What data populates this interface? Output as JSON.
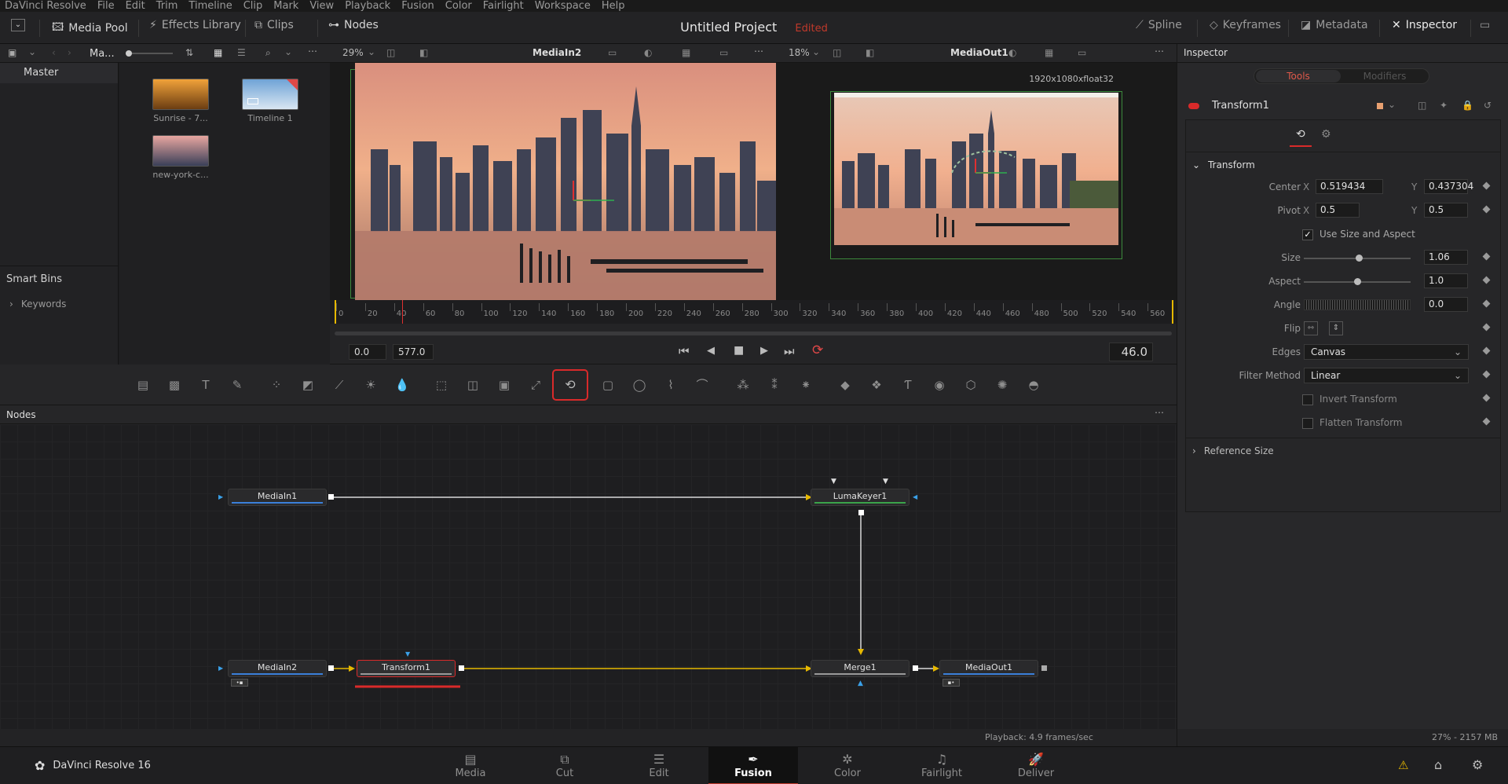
{
  "menu": [
    "DaVinci Resolve",
    "File",
    "Edit",
    "Trim",
    "Timeline",
    "Clip",
    "Mark",
    "View",
    "Playback",
    "Fusion",
    "Color",
    "Fairlight",
    "Workspace",
    "Help"
  ],
  "toolbar": {
    "media_pool": "Media Pool",
    "effects_library": "Effects Library",
    "clips": "Clips",
    "nodes": "Nodes",
    "project_title": "Untitled Project",
    "project_status": "Edited",
    "spline": "Spline",
    "keyframes": "Keyframes",
    "metadata": "Metadata",
    "inspector": "Inspector"
  },
  "media_pool": {
    "breadcrumb": "Ma...",
    "bins": {
      "master": "Master",
      "smart_bins": "Smart Bins",
      "keywords": "Keywords"
    },
    "clips": [
      {
        "name": "Sunrise - 7...",
        "colors": [
          "#f1a23a",
          "#6b3d12"
        ]
      },
      {
        "name": "Timeline 1",
        "colors": [
          "#6fa3d6",
          "#d9e6f2"
        ]
      },
      {
        "name": "new-york-c...",
        "colors": [
          "#e8a6a0",
          "#3a3f58"
        ]
      }
    ]
  },
  "viewer_left": {
    "zoom": "29%",
    "name": "MediaIn2"
  },
  "viewer_right": {
    "zoom": "18%",
    "name": "MediaOut1",
    "resolution": "1920x1080xfloat32"
  },
  "timeline": {
    "ticks": [
      "0",
      "20",
      "40",
      "60",
      "80",
      "100",
      "120",
      "140",
      "160",
      "180",
      "200",
      "220",
      "240",
      "260",
      "280",
      "300",
      "320",
      "340",
      "360",
      "380",
      "400",
      "420",
      "440",
      "460",
      "480",
      "500",
      "520",
      "540",
      "560"
    ],
    "start": "0.0",
    "end": "577.0",
    "current": "46.0"
  },
  "nodes_panel": {
    "title": "Nodes",
    "nodes": {
      "mediain1": "MediaIn1",
      "lumakeyer1": "LumaKeyer1",
      "mediain2": "MediaIn2",
      "transform1": "Transform1",
      "merge1": "Merge1",
      "mediaout1": "MediaOut1"
    }
  },
  "status": {
    "playback": "Playback: 4.9 frames/sec",
    "memory": "27% - 2157 MB"
  },
  "inspector": {
    "title": "Inspector",
    "tabs": {
      "tools": "Tools",
      "modifiers": "Modifiers"
    },
    "tool_name": "Transform1",
    "section": "Transform",
    "center_label": "Center",
    "center_x": "0.519434",
    "center_y": "0.437304",
    "pivot_label": "Pivot",
    "pivot_x": "0.5",
    "pivot_y": "0.5",
    "x": "X",
    "y": "Y",
    "use_size_aspect": "Use Size and Aspect",
    "size_label": "Size",
    "size": "1.06",
    "aspect_label": "Aspect",
    "aspect": "1.0",
    "angle_label": "Angle",
    "angle": "0.0",
    "flip_label": "Flip",
    "edges_label": "Edges",
    "edges": "Canvas",
    "filter_label": "Filter Method",
    "filter": "Linear",
    "invert": "Invert Transform",
    "flatten": "Flatten Transform",
    "reference_size": "Reference Size"
  },
  "pages": {
    "app_name": "DaVinci Resolve 16",
    "media": "Media",
    "cut": "Cut",
    "edit": "Edit",
    "fusion": "Fusion",
    "color": "Color",
    "fairlight": "Fairlight",
    "deliver": "Deliver"
  },
  "colors": {
    "accent_red": "#c0392b",
    "node_link_yellow": "#e6b800",
    "bg": "#1c1c1e"
  }
}
